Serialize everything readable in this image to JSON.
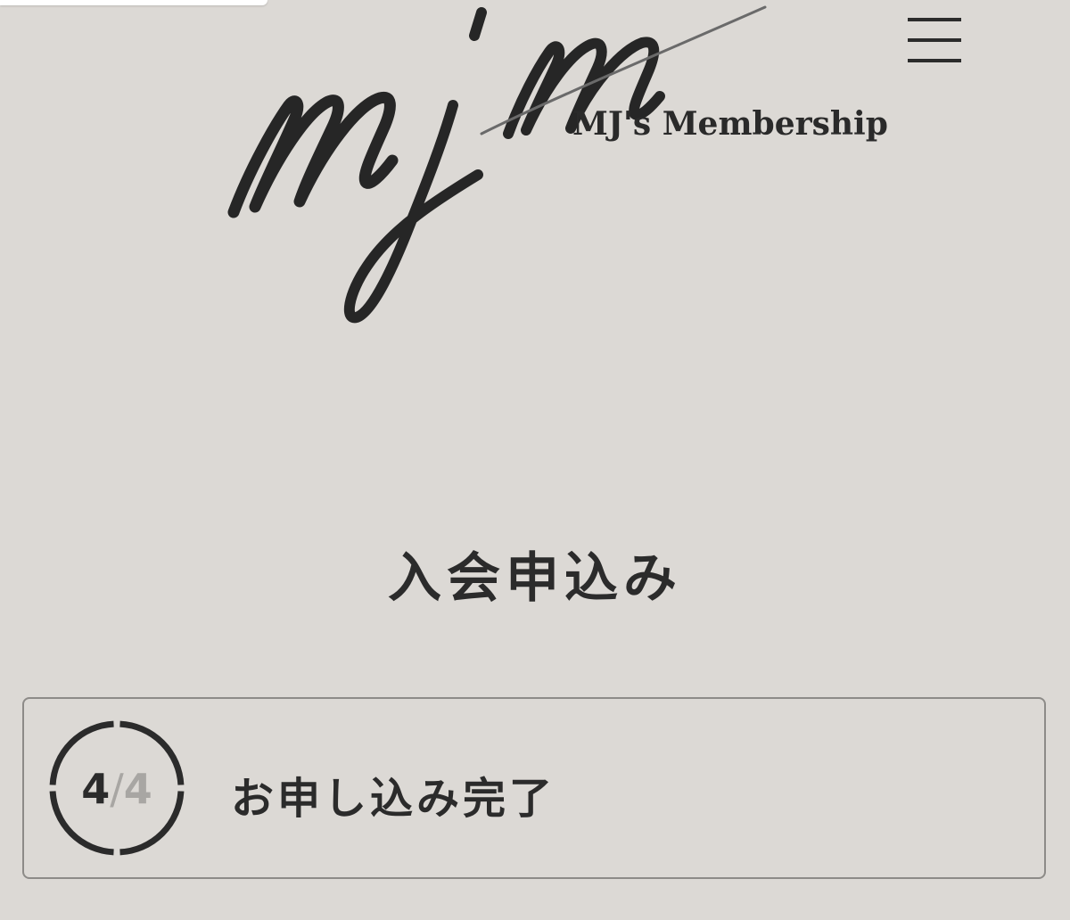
{
  "header": {
    "brand_name": "MJ's Membership",
    "logo_icon": "mjm-script-logo",
    "menu_icon": "hamburger-menu-icon"
  },
  "main": {
    "title": "入会申込み",
    "step": {
      "current": "4",
      "separator": "/",
      "total": "4",
      "label": "お申し込み完了"
    }
  },
  "colors": {
    "background": "#dcd9d5",
    "text": "#2b2b2b",
    "muted": "#a8a6a3",
    "border": "#8d8b88"
  }
}
